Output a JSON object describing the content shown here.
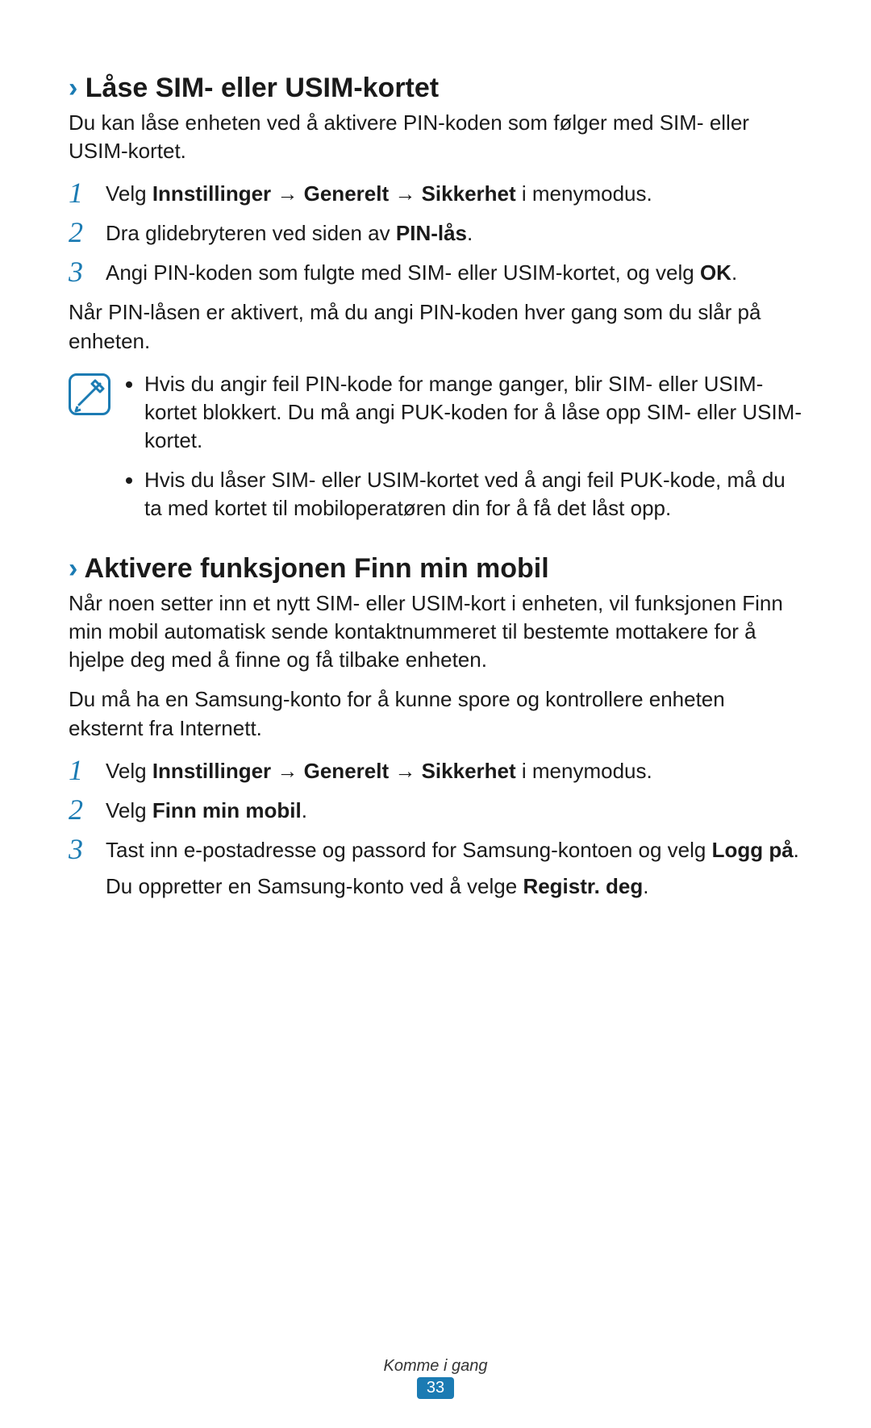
{
  "section1": {
    "title": "Låse SIM- eller USIM-kortet",
    "intro": "Du kan låse enheten ved å aktivere PIN-koden som følger med SIM- eller USIM-kortet.",
    "steps": [
      {
        "num": "1",
        "prefix": "Velg ",
        "bold1": "Innstillinger",
        "arr1": " → ",
        "bold2": "Generelt",
        "arr2": " → ",
        "bold3": "Sikkerhet",
        "suffix": " i menymodus."
      },
      {
        "num": "2",
        "prefix": "Dra glidebryteren ved siden av ",
        "bold1": "PIN-lås",
        "suffix": "."
      },
      {
        "num": "3",
        "prefix": "Angi PIN-koden som fulgte med SIM- eller USIM-kortet, og velg ",
        "bold1": "OK",
        "suffix": "."
      }
    ],
    "after": "Når PIN-låsen er aktivert, må du angi PIN-koden hver gang som du slår på enheten.",
    "notes": [
      "Hvis du angir feil PIN-kode for mange ganger, blir SIM- eller USIM-kortet blokkert. Du må angi PUK-koden for å låse opp SIM- eller USIM-kortet.",
      "Hvis du låser SIM- eller USIM-kortet ved å angi feil PUK-kode, må du ta med kortet til mobiloperatøren din for å få det låst opp."
    ]
  },
  "section2": {
    "title": "Aktivere funksjonen Finn min mobil",
    "intro1": "Når noen setter inn et nytt SIM- eller USIM-kort i enheten, vil funksjonen Finn min mobil automatisk sende kontaktnummeret til bestemte mottakere for å hjelpe deg med å finne og få tilbake enheten.",
    "intro2": "Du må ha en Samsung-konto for å kunne spore og kontrollere enheten eksternt fra Internett.",
    "steps": [
      {
        "num": "1",
        "prefix": "Velg ",
        "bold1": "Innstillinger",
        "arr1": " → ",
        "bold2": "Generelt",
        "arr2": " → ",
        "bold3": "Sikkerhet",
        "suffix": " i menymodus."
      },
      {
        "num": "2",
        "prefix": "Velg ",
        "bold1": "Finn min mobil",
        "suffix": "."
      },
      {
        "num": "3",
        "prefix": "Tast inn e-postadresse og passord for Samsung-kontoen og velg ",
        "bold1": "Logg på",
        "suffix": ".",
        "sub_prefix": "Du oppretter en Samsung-konto ved å velge ",
        "sub_bold": "Registr. deg",
        "sub_suffix": "."
      }
    ]
  },
  "footer": {
    "label": "Komme i gang",
    "page": "33"
  }
}
